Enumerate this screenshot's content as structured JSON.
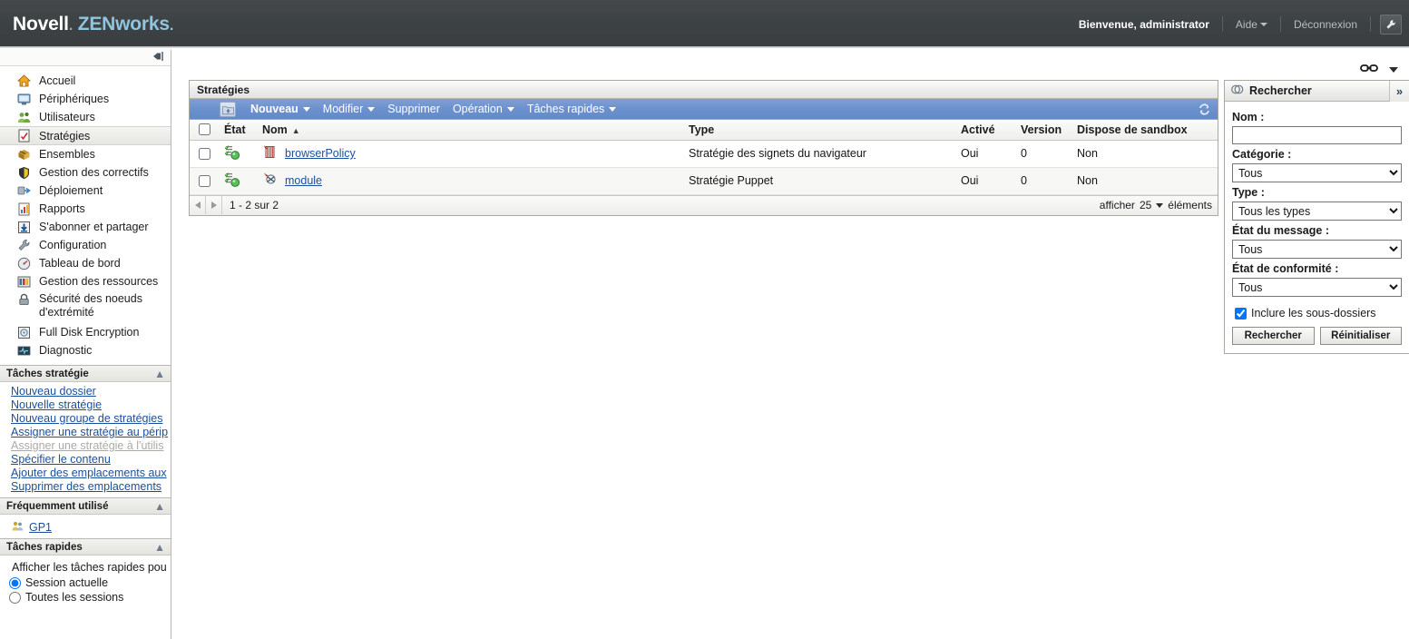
{
  "banner": {
    "brand_novell": "Novell",
    "brand_zen": "ZENworks",
    "welcome": "Bienvenue, administrator",
    "help": "Aide",
    "logout": "Déconnexion",
    "tool_icon": "wrench-icon"
  },
  "sidebar": {
    "collapse_icon": "collapse-panel-icon",
    "items": [
      {
        "label": "Accueil",
        "icon": "home-icon"
      },
      {
        "label": "Périphériques",
        "icon": "monitor-icon"
      },
      {
        "label": "Utilisateurs",
        "icon": "users-icon"
      },
      {
        "label": "Stratégies",
        "icon": "policy-icon"
      },
      {
        "label": "Ensembles",
        "icon": "bundle-box-icon"
      },
      {
        "label": "Gestion des correctifs",
        "icon": "shield-icon"
      },
      {
        "label": "Déploiement",
        "icon": "deploy-icon"
      },
      {
        "label": "Rapports",
        "icon": "report-icon"
      },
      {
        "label": "S'abonner et partager",
        "icon": "subscribe-icon"
      },
      {
        "label": "Configuration",
        "icon": "wrench-icon"
      },
      {
        "label": "Tableau de bord",
        "icon": "gauge-icon"
      },
      {
        "label": "Gestion des ressources",
        "icon": "asset-icon"
      },
      {
        "label": "Sécurité des noeuds",
        "label2": "d'extrémité",
        "icon": "lock-icon"
      },
      {
        "label": "Full Disk Encryption",
        "icon": "disk-encryption-icon"
      },
      {
        "label": "Diagnostic",
        "icon": "diagnostic-icon"
      }
    ],
    "selected_index": 3,
    "policy_tasks": {
      "title": "Tâches stratégie",
      "collapse_icon": "chevron-up-icon",
      "links": [
        {
          "label": "Nouveau dossier",
          "disabled": false
        },
        {
          "label": "Nouvelle stratégie",
          "disabled": false
        },
        {
          "label": "Nouveau groupe de stratégies",
          "disabled": false
        },
        {
          "label": "Assigner une stratégie au périp",
          "disabled": false
        },
        {
          "label": "Assigner une stratégie à l'utilis",
          "disabled": true
        },
        {
          "label": "Spécifier le contenu",
          "disabled": false
        },
        {
          "label": "Ajouter des emplacements aux",
          "disabled": false
        },
        {
          "label": "Supprimer des emplacements ",
          "disabled": false
        }
      ]
    },
    "frequently_used": {
      "title": "Fréquemment utilisé",
      "collapse_icon": "chevron-up-icon",
      "items": [
        {
          "label": "GP1",
          "icon": "group-icon"
        }
      ]
    },
    "quick_tasks": {
      "title": "Tâches rapides",
      "collapse_icon": "chevron-up-icon",
      "description": "Afficher les tâches rapides pou",
      "options": [
        {
          "label": "Session actuelle",
          "selected": true
        },
        {
          "label": "Toutes les sessions",
          "selected": false
        }
      ]
    }
  },
  "content": {
    "top_controls": {
      "link_icon": "chain-link-icon",
      "dropdown_icon": "chevron-down-icon"
    },
    "list_panel": {
      "title": "Stratégies",
      "toolbar": {
        "folder_up_icon": "folder-up-icon",
        "refresh_icon": "refresh-icon",
        "items": [
          {
            "label": "Nouveau",
            "has_caret": true,
            "strong": true
          },
          {
            "label": "Modifier",
            "has_caret": true,
            "strong": false
          },
          {
            "label": "Supprimer",
            "has_caret": false,
            "strong": false
          },
          {
            "label": "Opération",
            "has_caret": true,
            "strong": false
          },
          {
            "label": "Tâches rapides",
            "has_caret": true,
            "strong": false
          }
        ]
      },
      "columns": [
        "État",
        "Nom",
        "Type",
        "Activé",
        "Version",
        "Dispose de sandbox"
      ],
      "sort_column": "Nom",
      "sort_icon": "sort-ascending-icon",
      "rows": [
        {
          "state_icon": "policy-status-ok-icon",
          "type_icon": "browser-bookmark-policy-icon",
          "name": "browserPolicy",
          "type": "Stratégie des signets du navigateur",
          "enabled": "Oui",
          "version": "0",
          "sandbox": "Non"
        },
        {
          "state_icon": "policy-status-ok-icon",
          "type_icon": "puppet-policy-icon",
          "name": "module",
          "type": "Stratégie Puppet",
          "enabled": "Oui",
          "version": "0",
          "sandbox": "Non"
        }
      ],
      "footer": {
        "prev_icon": "page-prev-icon",
        "next_icon": "page-next-icon",
        "range": "1 - 2 sur 2",
        "show_label": "afficher",
        "page_size": "25",
        "items_label": "éléments"
      }
    },
    "search_panel": {
      "title": "Rechercher",
      "title_icon": "search-rings-icon",
      "expand_icon": "expand-right-icon",
      "name_label": "Nom :",
      "name_value": "",
      "name_placeholder": "",
      "category_label": "Catégorie :",
      "category_value": "Tous",
      "type_label": "Type :",
      "type_value": "Tous les types",
      "message_state_label": "État du message :",
      "message_state_value": "Tous",
      "compliance_state_label": "État de conformité :",
      "compliance_state_value": "Tous",
      "include_subfolders_label": "Inclure les sous-dossiers",
      "include_subfolders_checked": true,
      "search_button": "Rechercher",
      "reset_button": "Réinitialiser"
    }
  },
  "colors": {
    "banner_bg": "#3d4245",
    "brand_accent": "#8fc5de",
    "toolbar_blue": "#6b91ce",
    "link_blue": "#1b4f9c",
    "panel_border": "#a9a9a4"
  }
}
